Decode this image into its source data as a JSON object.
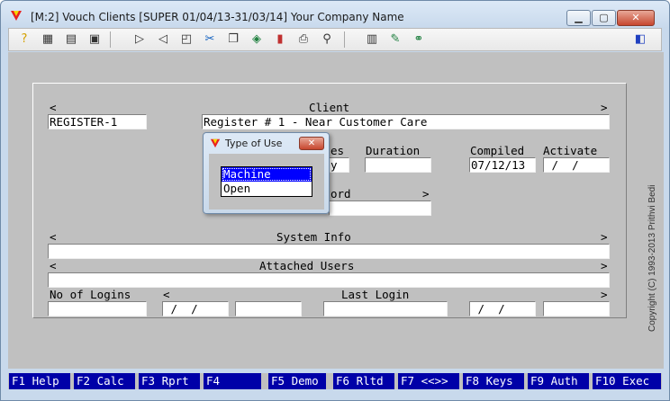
{
  "window": {
    "title": "[M:2]  Vouch Clients  [SUPER  01/04/13-31/03/14]  Your Company Name",
    "minimize_glyph": "▁",
    "maximize_glyph": "▢",
    "close_glyph": "✕"
  },
  "toolbar": {
    "icons": [
      "help-icon",
      "grid-icon",
      "table-icon",
      "print-preview-icon",
      "next-icon",
      "prev-icon",
      "form-icon",
      "tools-icon",
      "copy-icon",
      "stack-icon",
      "chart-icon",
      "printer-icon",
      "search-icon",
      "notes-icon",
      "edit-icon",
      "link-icon",
      "exit-icon"
    ]
  },
  "form": {
    "client_label": "Client",
    "left_arrow": "<",
    "right_arrow": ">",
    "register_code": "REGISTER-1",
    "client_name": "Register # 1 - Near Customer Care",
    "types_label_partial": "es",
    "duration_label": "Duration",
    "compiled_label": "Compiled",
    "activate_label": "Activate",
    "types_value_partial": "y",
    "duration_value": "",
    "compiled_value": "07/12/13",
    "activate_value": " /  /",
    "password_label_partial": "ord",
    "password_arrow": ">",
    "system_info_label": "System Info",
    "attached_users_label": "Attached Users",
    "no_of_logins_label": "No of Logins",
    "last_login_label": "Last Login",
    "date_blank_1": " /  /",
    "date_blank_2": " /  /"
  },
  "popup": {
    "title": "Type of Use",
    "close_glyph": "✕",
    "options": [
      "Machine",
      "Open"
    ],
    "selected": "Machine"
  },
  "fkeys": [
    "F1 Help",
    "F2 Calc",
    "F3 Rprt",
    "F4",
    "F5 Demo",
    "F6 Rltd",
    "F7 <<>>",
    "F8 Keys",
    "F9 Auth",
    "F10 Exec"
  ],
  "copyright": "Copyright (C) 1993-2013 Prithvi Bedi",
  "colors": {
    "fkey_bg": "#0000a8",
    "client_bg": "#c0c0c0",
    "selection": "#0000ff"
  }
}
